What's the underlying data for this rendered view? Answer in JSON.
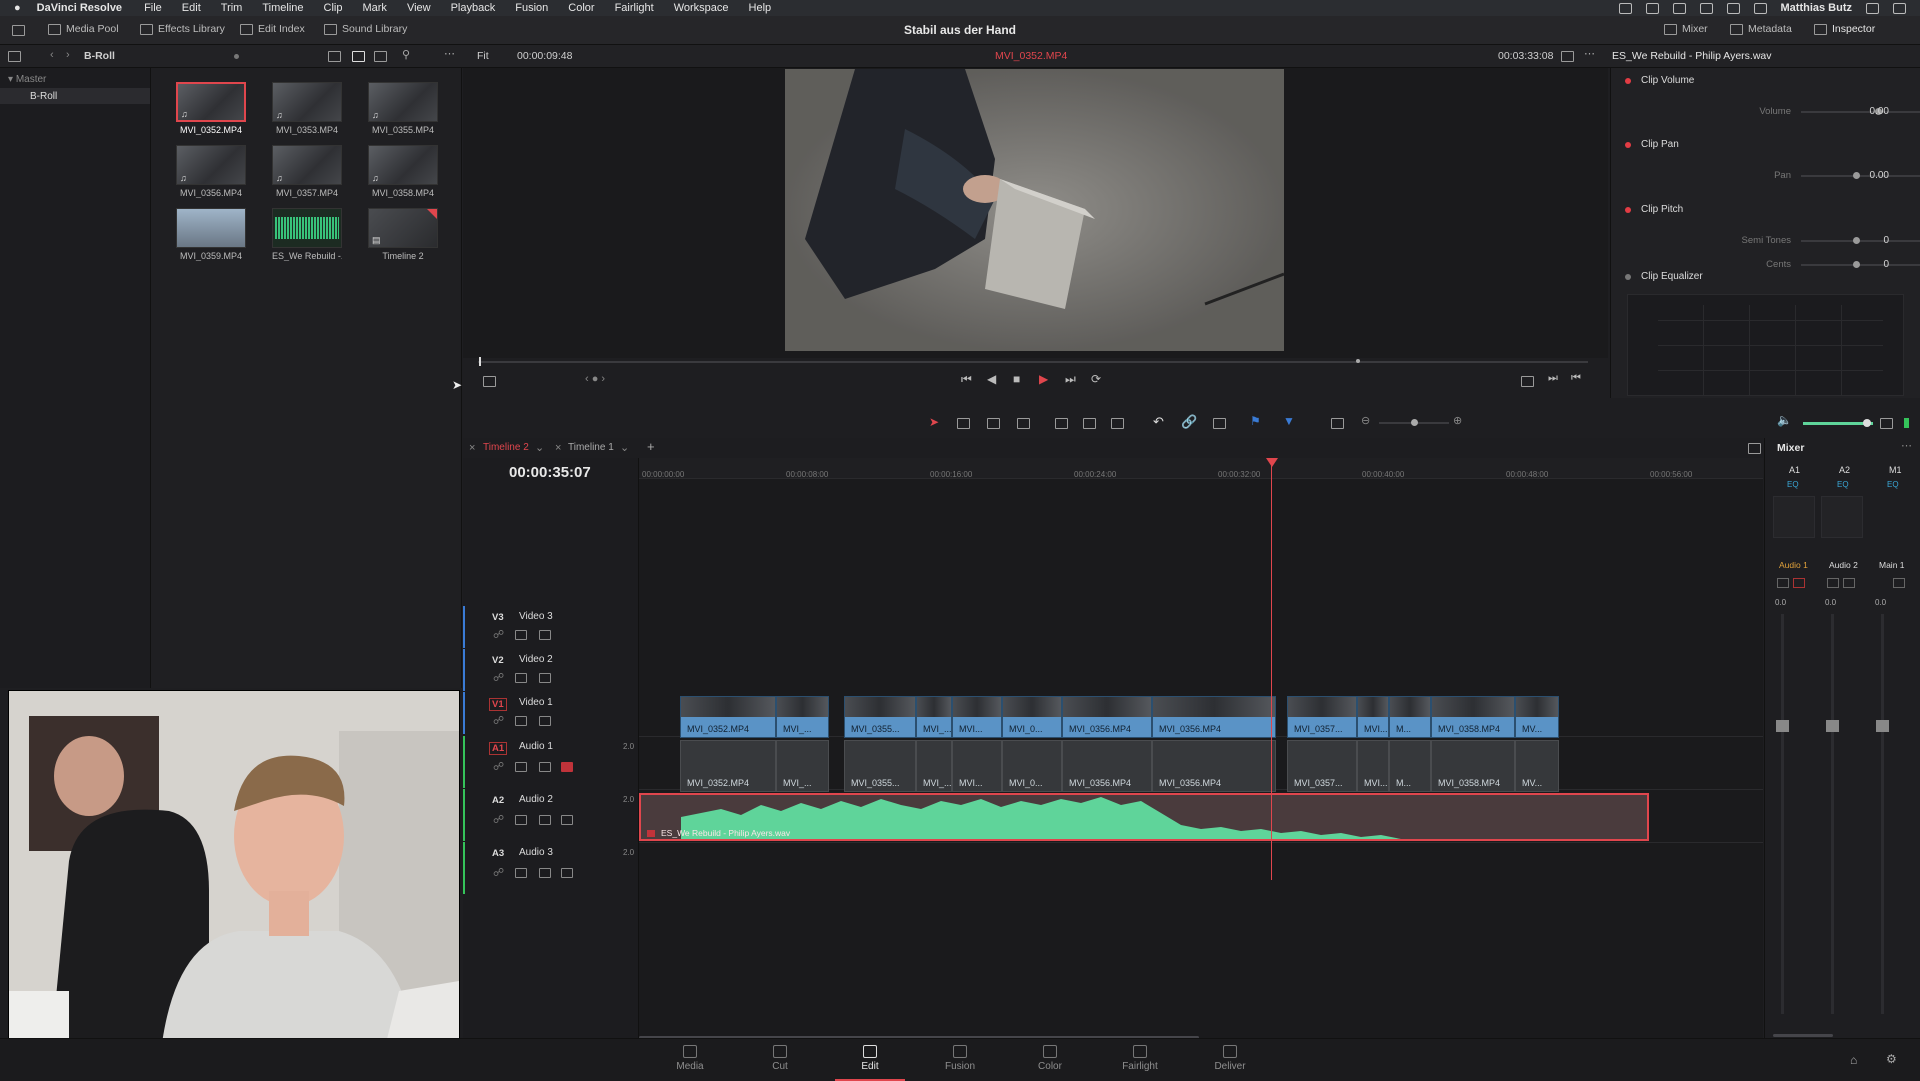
{
  "menubar": {
    "app_name": "DaVinci Resolve",
    "menus": [
      "File",
      "Edit",
      "Trim",
      "Timeline",
      "Clip",
      "Mark",
      "View",
      "Playback",
      "Fusion",
      "Color",
      "Fairlight",
      "Workspace",
      "Help"
    ],
    "user": "Matthias Butz"
  },
  "toolbar": {
    "media_pool": "Media Pool",
    "effects_library": "Effects Library",
    "edit_index": "Edit Index",
    "sound_library": "Sound Library",
    "project_title": "Stabil aus der Hand",
    "mixer": "Mixer",
    "metadata": "Metadata",
    "inspector": "Inspector"
  },
  "pool_header": {
    "bin_name": "B-Roll",
    "fit": "Fit",
    "source_timecode": "00:00:09:48",
    "clip_name": "MVI_0352.MP4",
    "duration_timecode": "00:03:33:08",
    "inspector_clip": "ES_We Rebuild - Philip Ayers.wav"
  },
  "bins": {
    "master": "Master",
    "broll": "B-Roll"
  },
  "pool_clips": [
    {
      "name": "MVI_0352.MP4"
    },
    {
      "name": "MVI_0353.MP4"
    },
    {
      "name": "MVI_0355.MP4"
    },
    {
      "name": "MVI_0356.MP4"
    },
    {
      "name": "MVI_0357.MP4"
    },
    {
      "name": "MVI_0358.MP4"
    },
    {
      "name": "MVI_0359.MP4"
    },
    {
      "name": "ES_We Rebuild -..."
    },
    {
      "name": "Timeline 2"
    }
  ],
  "inspector": {
    "clip_volume": "Clip Volume",
    "volume_label": "Volume",
    "volume_value": "0.00",
    "clip_pan": "Clip Pan",
    "pan_label": "Pan",
    "pan_value": "0.00",
    "clip_pitch": "Clip Pitch",
    "semitones_label": "Semi Tones",
    "semitones_value": "0",
    "cents_label": "Cents",
    "cents_value": "0",
    "clip_equalizer": "Clip Equalizer"
  },
  "timeline": {
    "tab_active": "Timeline 2",
    "tab_other": "Timeline 1",
    "timecode": "00:00:35:07",
    "ruler": [
      "00:00:00:00",
      "00:00:08:00",
      "00:00:16:00",
      "00:00:24:00",
      "00:00:32:00",
      "00:00:40:00",
      "00:00:48:00",
      "00:00:56:00"
    ],
    "tracks": [
      {
        "code": "V3",
        "name": "Video 3"
      },
      {
        "code": "V2",
        "name": "Video 2"
      },
      {
        "code": "V1",
        "name": "Video 1"
      },
      {
        "code": "A1",
        "name": "Audio 1",
        "ch": "2.0"
      },
      {
        "code": "A2",
        "name": "Audio 2",
        "ch": "2.0"
      },
      {
        "code": "A3",
        "name": "Audio 3",
        "ch": "2.0"
      }
    ],
    "video_clips": [
      "MVI_0352.MP4",
      "MVI_...",
      "MVI_0355...",
      "MVI_...",
      "MVI...",
      "MVI_0...",
      "MVI_0356.MP4",
      "MVI_0356.MP4",
      "MVI_0357...",
      "MVI...",
      "M...",
      "MVI_0358.MP4",
      "MV..."
    ],
    "music_clip": "ES_We Rebuild - Philip Ayers.wav"
  },
  "mixer": {
    "title": "Mixer",
    "channels": [
      "A1",
      "A2",
      "M1"
    ],
    "eq": "EQ",
    "strip_names": [
      "Audio 1",
      "Audio 2",
      "Main 1"
    ],
    "db_values": [
      "0.0",
      "0.0",
      "0.0"
    ]
  },
  "pages": [
    "Media",
    "Cut",
    "Edit",
    "Fusion",
    "Color",
    "Fairlight",
    "Deliver"
  ],
  "active_page": "Edit",
  "colors": {
    "accent_red": "#e0464d",
    "clip_blue": "#5a93c6",
    "wave_green": "#5fd49a"
  }
}
